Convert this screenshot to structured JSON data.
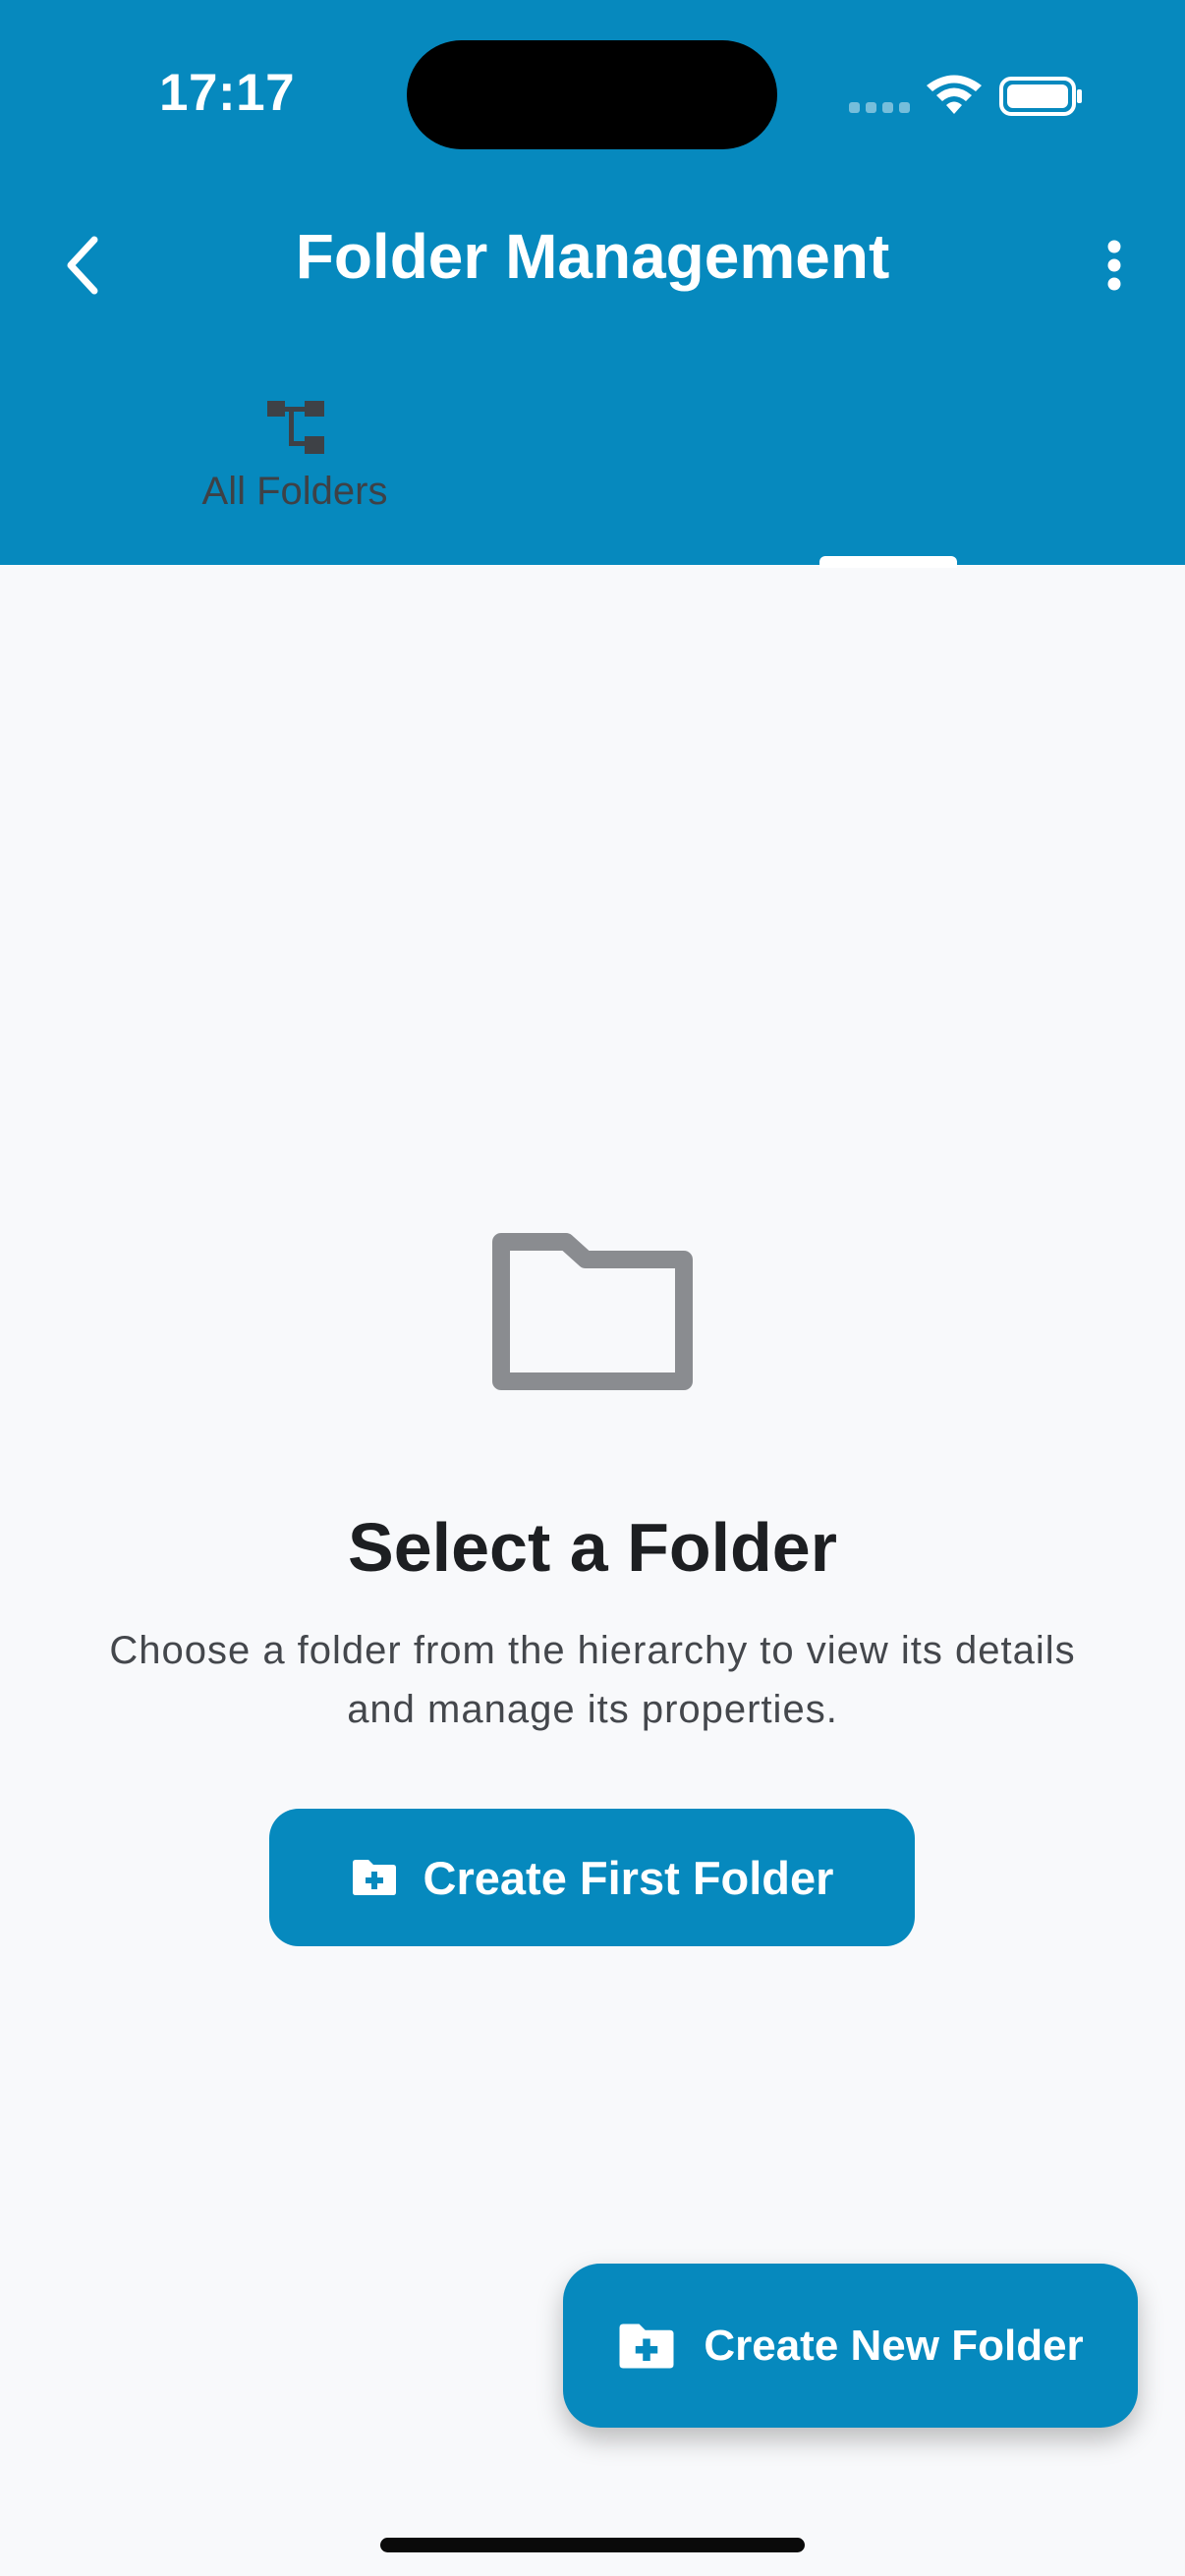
{
  "status_bar": {
    "time": "17:17"
  },
  "header": {
    "title": "Folder Management",
    "back_icon": "chevron-left-icon",
    "menu_icon": "more-vertical-icon"
  },
  "tabs": [
    {
      "label": "All Folders",
      "icon": "folder-tree-icon"
    }
  ],
  "empty_state": {
    "icon": "folder-outline-icon",
    "title": "Select a Folder",
    "description": "Choose a folder from the hierarchy to view its details and manage its properties.",
    "button_label": "Create First Folder",
    "button_icon": "folder-plus-icon"
  },
  "fab": {
    "label": "Create New Folder",
    "icon": "folder-plus-icon"
  },
  "colors": {
    "primary": "#0689be",
    "background": "#f8f9fb",
    "title_text": "#1d1f22",
    "body_text": "#44474c",
    "icon_gray": "#8a8c90"
  }
}
